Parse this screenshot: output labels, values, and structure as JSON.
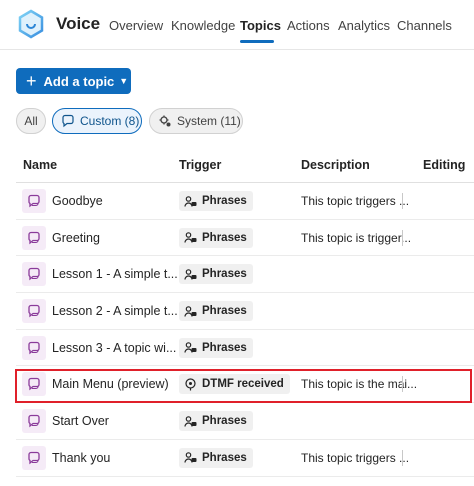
{
  "app": {
    "title": "Voice"
  },
  "nav": [
    {
      "label": "Overview",
      "active": false
    },
    {
      "label": "Knowledge",
      "active": false
    },
    {
      "label": "Topics",
      "active": true
    },
    {
      "label": "Actions",
      "active": false
    },
    {
      "label": "Analytics",
      "active": false
    },
    {
      "label": "Channels",
      "active": false
    }
  ],
  "toolbar": {
    "add_topic_label": "Add a topic"
  },
  "filters": {
    "all": "All",
    "custom": "Custom (8)",
    "system": "System (11)"
  },
  "table": {
    "headers": {
      "name": "Name",
      "trigger": "Trigger",
      "description": "Description",
      "editing": "Editing"
    },
    "rows": [
      {
        "name": "Goodbye",
        "trigger": "Phrases",
        "description": "This topic triggers ..."
      },
      {
        "name": "Greeting",
        "trigger": "Phrases",
        "description": "This topic is trigger..."
      },
      {
        "name": "Lesson 1 - A simple t...",
        "trigger": "Phrases",
        "description": ""
      },
      {
        "name": "Lesson 2 - A simple t...",
        "trigger": "Phrases",
        "description": ""
      },
      {
        "name": "Lesson 3 - A topic wi...",
        "trigger": "Phrases",
        "description": ""
      },
      {
        "name": "Main Menu (preview)",
        "trigger": "DTMF received",
        "description": "This topic is the mai..."
      },
      {
        "name": "Start Over",
        "trigger": "Phrases",
        "description": ""
      },
      {
        "name": "Thank you",
        "trigger": "Phrases",
        "description": "This topic triggers ..."
      }
    ]
  },
  "colors": {
    "accent": "#0f6cbd",
    "highlight": "#e0202a",
    "topic_icon": "#8a3b9a"
  },
  "icons": {
    "logo": "copilot-studio-logo",
    "topic": "chat-bubble-icon",
    "phrases": "person-chat-icon",
    "dtmf": "keypad-icon",
    "system": "gear-chat-icon"
  }
}
